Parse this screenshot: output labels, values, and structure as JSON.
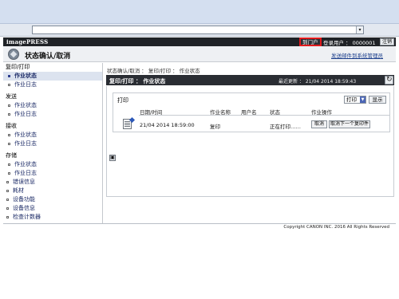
{
  "browser": {
    "url_value": "",
    "dropdown_glyph": "▾"
  },
  "header": {
    "app_name": "imagePRESS",
    "portal_label": "到门户",
    "login_user": "登录用户 ： 0000001",
    "logout_label": "注销"
  },
  "title": {
    "text": "状态确认/取消",
    "admin_link": "发送邮件到系统管理员"
  },
  "sidebar": {
    "sections": [
      {
        "label": "复印/打印",
        "items": [
          "作业状态",
          "作业日志"
        ]
      },
      {
        "label": "发送",
        "items": [
          "作业状态",
          "作业日志"
        ]
      },
      {
        "label": "接收",
        "items": [
          "作业状态",
          "作业日志"
        ]
      },
      {
        "label": "存储",
        "items": [
          "作业状态",
          "作业日志"
        ]
      }
    ],
    "top_items": [
      "错误信息",
      "耗材",
      "设备功能",
      "设备信息",
      "检查计数器"
    ]
  },
  "content": {
    "breadcrumb": "状态确认/取消 ： 复印/打印 ： 作业状态",
    "panel_title": "复印/打印 ： 作业状态",
    "updated": "最近更新 ： 21/04 2014 18:59:43",
    "list_label": "打印",
    "filter_value": "打印",
    "show_label": "显示",
    "columns": [
      "日期/时间",
      "作业名称",
      "用户名",
      "状态",
      "作业操作"
    ],
    "rows": [
      {
        "datetime": "21/04 2014 18:59:00",
        "job_name": "复印",
        "user": "",
        "status": "正在打印……",
        "cancel_label": "取消",
        "next_label": "取消下一个复印件"
      }
    ],
    "page_button": "▣"
  },
  "footer": {
    "copyright": "Copyright CANON INC. 2016 All Rights Reserved"
  }
}
